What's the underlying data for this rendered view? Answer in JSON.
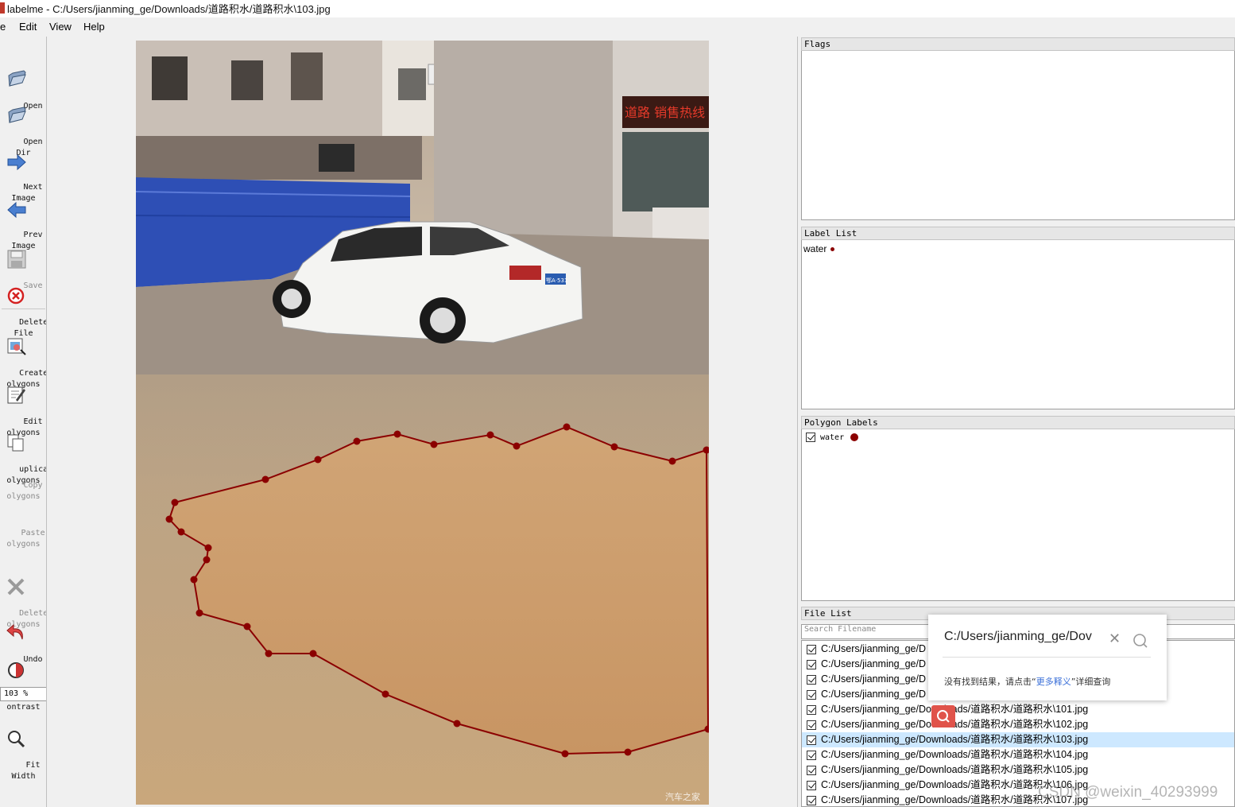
{
  "window": {
    "title": "labelme - C:/Users/jianming_ge/Downloads/道路积水/道路积水\\103.jpg"
  },
  "menu": {
    "file": "e",
    "edit": "Edit",
    "view": "View",
    "help": "Help"
  },
  "toolbar": {
    "open": "Open",
    "open_dir": "Open\nDir",
    "next_image": "Next\nImage",
    "prev_image": "Prev\nImage",
    "save": "Save",
    "delete_file": "Delete\nFile",
    "create_polygons": "Create\nolygons",
    "edit_polygons": "Edit\nolygons",
    "duplicate_polygons": "uplicate\nolygons",
    "copy_polygons": "Copy\nolygons",
    "paste_polygons": "Paste\nolygons",
    "delete_polygons": "Delete\nolygons",
    "undo": "Undo",
    "brightness_contrast": "ightness\nontrast",
    "zoom_value": "103 %",
    "fit_width": "Fit\nWidth"
  },
  "docks": {
    "flags_title": "Flags",
    "label_list_title": "Label List",
    "label_list": [
      {
        "label": "water",
        "color": "#8b0000"
      }
    ],
    "polygon_labels_title": "Polygon Labels",
    "polygon_labels": [
      {
        "label": "water",
        "checked": true,
        "color": "#8b0000"
      }
    ],
    "file_list_title": "File List",
    "search_placeholder": "Search Filename"
  },
  "file_list": [
    {
      "path": "C:/Users/jianming_ge/D",
      "checked": true,
      "selected": false
    },
    {
      "path": "C:/Users/jianming_ge/D",
      "checked": true,
      "selected": false
    },
    {
      "path": "C:/Users/jianming_ge/D",
      "checked": true,
      "selected": false
    },
    {
      "path": "C:/Users/jianming_ge/D",
      "checked": true,
      "selected": false
    },
    {
      "path": "C:/Users/jianming_ge/Downloads/道路积水/道路积水\\101.jpg",
      "checked": true,
      "selected": false
    },
    {
      "path": "C:/Users/jianming_ge/Downloads/道路积水/道路积水\\102.jpg",
      "checked": true,
      "selected": false
    },
    {
      "path": "C:/Users/jianming_ge/Downloads/道路积水/道路积水\\103.jpg",
      "checked": true,
      "selected": true
    },
    {
      "path": "C:/Users/jianming_ge/Downloads/道路积水/道路积水\\104.jpg",
      "checked": true,
      "selected": false
    },
    {
      "path": "C:/Users/jianming_ge/Downloads/道路积水/道路积水\\105.jpg",
      "checked": true,
      "selected": false
    },
    {
      "path": "C:/Users/jianming_ge/Downloads/道路积水/道路积水\\106.jpg",
      "checked": true,
      "selected": false
    },
    {
      "path": "C:/Users/jianming_ge/Downloads/道路积水/道路积水\\107.jpg",
      "checked": true,
      "selected": false
    }
  ],
  "popup": {
    "query": "C:/Users/jianming_ge/Dov",
    "message_prefix": "没有找到结果，请点击“",
    "message_link": "更多释义",
    "message_suffix": "”详细查询"
  },
  "image": {
    "signage_text": "道路 销售热线",
    "photo_credit": "汽车之家",
    "plate_text": "鄂A·531"
  },
  "annotation": {
    "label": "water",
    "color": "#8b0000"
  },
  "watermark": "CSDN @weixin_40293999"
}
